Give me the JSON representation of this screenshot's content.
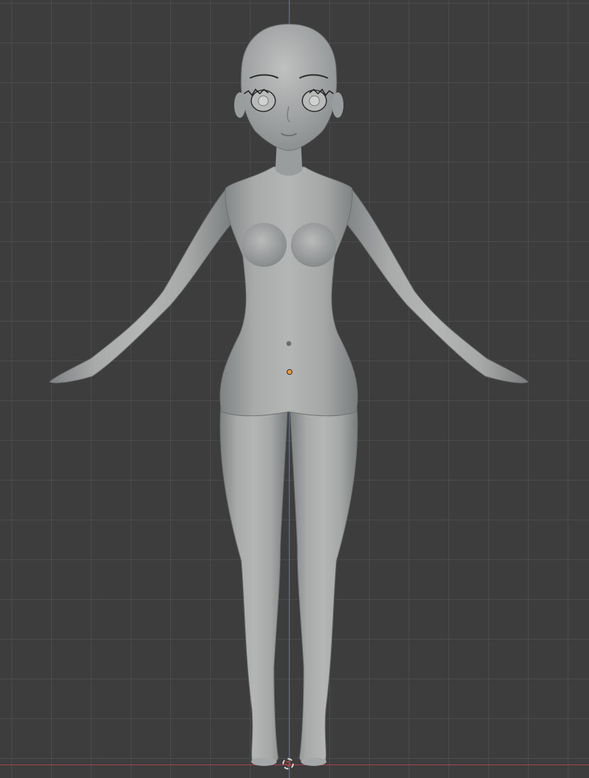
{
  "viewport": {
    "view": "front-orthographic",
    "background_color": "#3d3d3d",
    "grid": true,
    "axis_z_color": "#4a6fc2",
    "axis_x_color": "#b0404a",
    "selected_object_origin_color": "#f59a2c"
  },
  "scene": {
    "object": "stylized-female-base-mesh",
    "pose": "A-pose",
    "shading": "solid-grey"
  }
}
